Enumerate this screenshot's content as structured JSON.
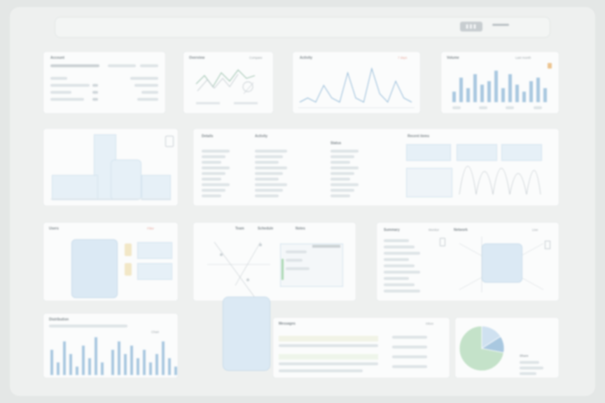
{
  "topbar": {
    "badge": "▮▮▮"
  },
  "panels": {
    "p1": {
      "title": "Account"
    },
    "p2": {
      "title": "Overview",
      "right": "Compare"
    },
    "p3": {
      "title": "Activity",
      "right": "7 days"
    },
    "p4": {
      "title": "Volume",
      "right": "Last month"
    },
    "p6": {
      "title": "Details",
      "col2": "Activity",
      "col3": "Status",
      "col4": "Recent items"
    },
    "p7": {
      "title": "Users",
      "right": "Filter"
    },
    "p8": {
      "tab1": "Team",
      "tab2": "Schedule",
      "tab3": "Notes"
    },
    "p9": {
      "title": "Summary",
      "right": "Monitor",
      "title2": "Network",
      "right2": "Live"
    },
    "p10": {
      "title": "Distribution",
      "right": "Chart"
    },
    "p11": {
      "title": "Messages",
      "right": "Inbox"
    },
    "p12": {
      "legend": "Share"
    }
  },
  "colors": {
    "accent": "#8fb7d6",
    "blue_fill": "#dbe9f4",
    "green": "#b7dfc0",
    "warn": "#e6a59a"
  },
  "chart_data": [
    {
      "type": "line",
      "series": [
        {
          "values": [
            4,
            7,
            3,
            8,
            5,
            9,
            6,
            7
          ]
        }
      ]
    },
    {
      "type": "line",
      "series": [
        {
          "values": [
            1,
            2,
            1,
            5,
            2,
            1,
            8,
            2,
            1,
            9,
            3,
            1,
            6,
            2,
            1
          ]
        }
      ]
    },
    {
      "type": "bar",
      "values": [
        3,
        7,
        4,
        8,
        5,
        6,
        9,
        4,
        8,
        5,
        3,
        6,
        7,
        4
      ]
    },
    {
      "type": "bar",
      "values": [
        6,
        3,
        8,
        5,
        2,
        7,
        4,
        9,
        3,
        6,
        8,
        5,
        7,
        4,
        6,
        3,
        5,
        8,
        4,
        2
      ]
    },
    {
      "type": "pie",
      "values": [
        72,
        16,
        12
      ]
    }
  ]
}
